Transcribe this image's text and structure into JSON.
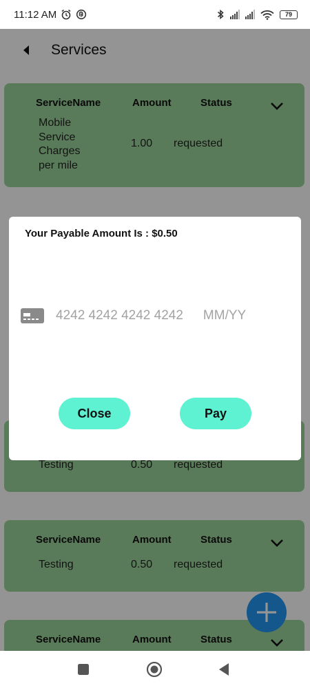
{
  "status_bar": {
    "time": "11:12 AM",
    "icons": [
      "alarm-icon",
      "notification-icon",
      "bluetooth-icon",
      "signal-icon",
      "signal-icon",
      "wifi-icon"
    ],
    "battery": "79"
  },
  "app_bar": {
    "title": "Services",
    "back_icon": "back-arrow-icon"
  },
  "colors": {
    "card_background": "#9cd49a",
    "button_background": "#5ef2d2",
    "fab_background": "#2196f3",
    "placeholder": "#a3a3a3"
  },
  "services": [
    {
      "name": "Mobile Service Charges per mile",
      "amount": "1.00",
      "status": "requested"
    },
    {
      "name": "Testing",
      "amount": "0.50",
      "status": "requested"
    },
    {
      "name": "Testing",
      "amount": "0.50",
      "status": "requested"
    }
  ],
  "columns": {
    "name": "ServiceName",
    "amount": "Amount",
    "status": "Status"
  },
  "dialog": {
    "title": "Your Payable Amount Is : $0.50",
    "card_icon": "credit-card-icon",
    "card_number_placeholder": "4242 4242 4242 4242",
    "expiry_placeholder": "MM/YY",
    "close_label": "Close",
    "pay_label": "Pay"
  },
  "fab": {
    "icon": "plus-icon"
  },
  "nav_bar": {
    "icons": [
      "recents-square-icon",
      "home-circle-icon",
      "back-triangle-icon"
    ]
  }
}
